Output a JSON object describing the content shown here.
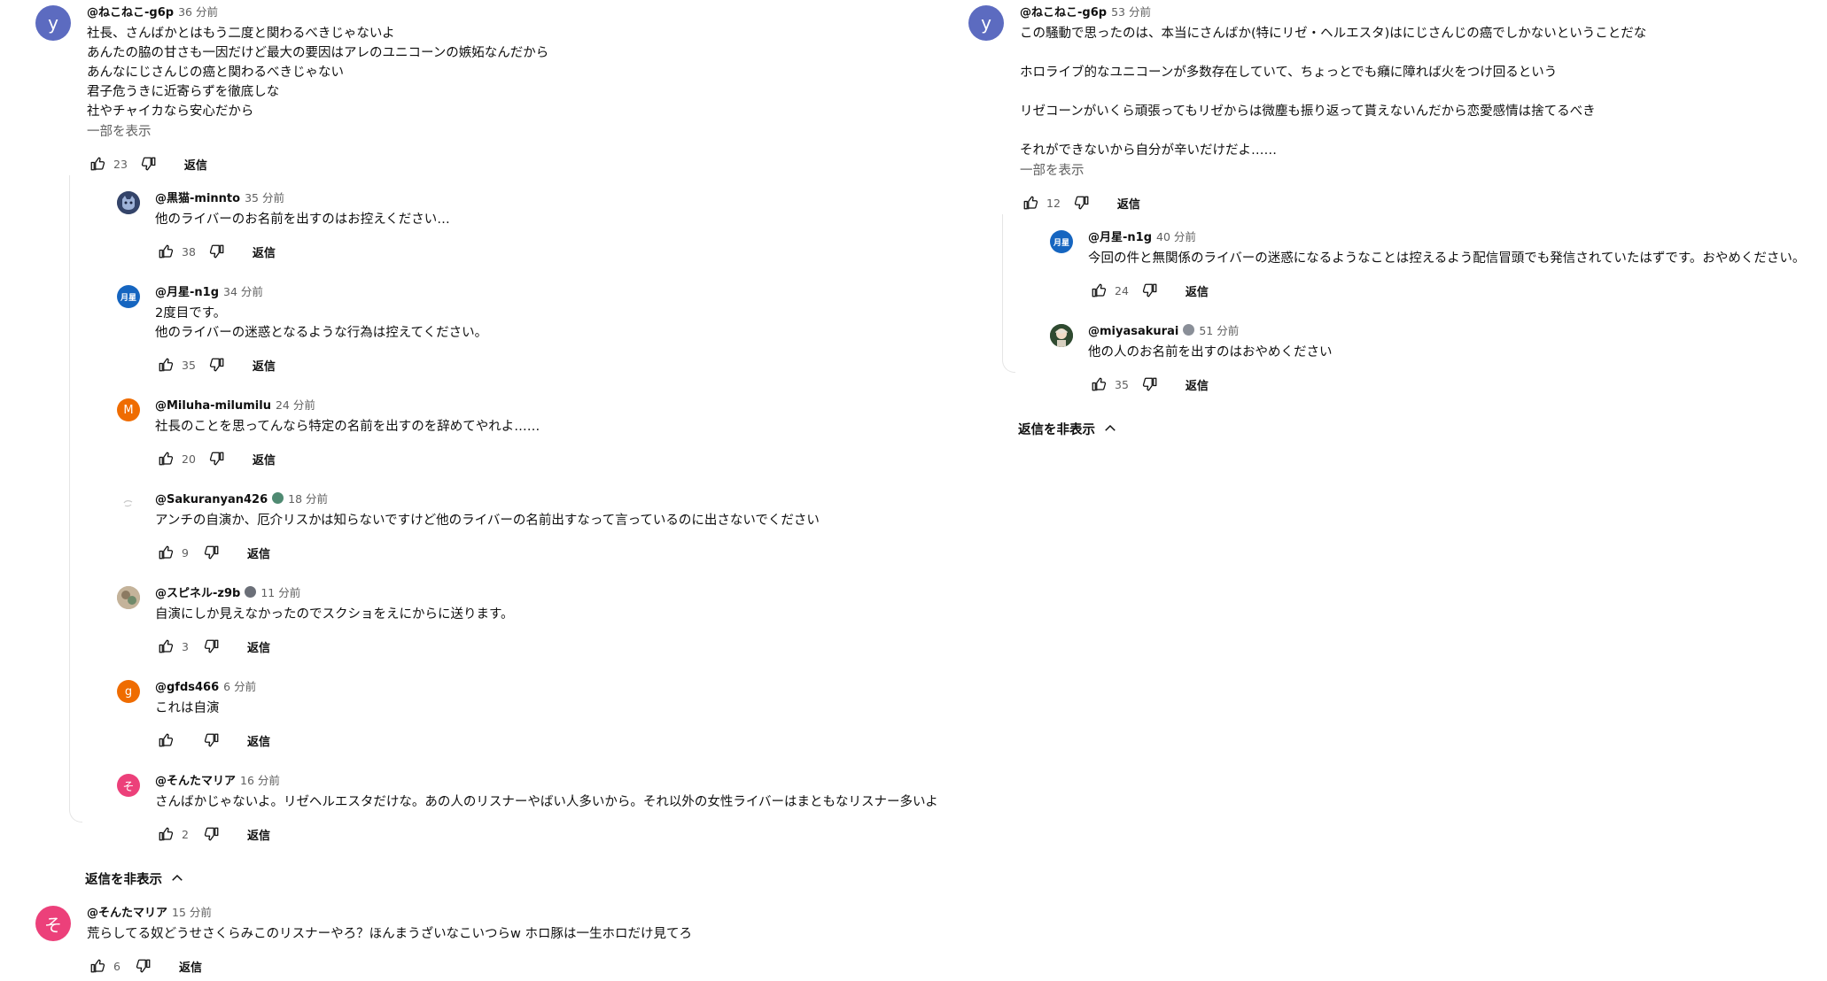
{
  "labels": {
    "reply": "返信",
    "show_more": "一部を表示",
    "hide_replies": "返信を非表示"
  },
  "colors": {
    "avatar_purple": "#5c6bc0",
    "avatar_orange": "#ef6c00",
    "avatar_pink": "#ec407a",
    "avatar_blue": "#1565c0"
  },
  "left": {
    "thread1": {
      "author": "@ねこねこ-g6p",
      "time": "36 分前",
      "avatar_letter": "y",
      "lines": [
        "社長、さんばかとはもう二度と関わるべきじゃないよ",
        "あんたの脇の甘さも一因だけど最大の要因はアレのユニコーンの嫉妬なんだから",
        "あんなにじさんじの癌と関わるべきじゃない",
        "君子危うきに近寄らずを徹底しな",
        "社やチャイカなら安心だから"
      ],
      "likes": "23",
      "replies": [
        {
          "author": "@黒猫-minnto",
          "time": "35 分前",
          "lines": [
            "他のライバーのお名前を出すのはお控えください…"
          ],
          "likes": "38",
          "avatar": "cat"
        },
        {
          "author": "@月星-n1g",
          "time": "34 分前",
          "lines": [
            "2度目です。",
            "他のライバーの迷惑となるような行為は控えてください。"
          ],
          "likes": "35",
          "avatar": "moon",
          "avatar_text": "月星"
        },
        {
          "author": "@Miluha-milumilu",
          "time": "24 分前",
          "lines": [
            "社長のことを思ってんなら特定の名前を出すのを辞めてやれよ……"
          ],
          "likes": "20",
          "avatar": "letter",
          "avatar_letter": "M"
        },
        {
          "author": "@Sakuranyan426",
          "time": "18 分前",
          "lines": [
            "アンチの自演か、厄介リスかは知らないですけど他のライバーの名前出すなって言っているのに出さないでください"
          ],
          "likes": "9",
          "avatar": "sketch",
          "badge": true
        },
        {
          "author": "@スピネル-z9b",
          "time": "11 分前",
          "lines": [
            "自演にしか見えなかったのでスクショをえにからに送ります。"
          ],
          "likes": "3",
          "avatar": "photo",
          "badge": true
        },
        {
          "author": "@gfds466",
          "time": "6 分前",
          "lines": [
            "これは自演"
          ],
          "likes": "",
          "avatar": "letter",
          "avatar_letter": "g"
        },
        {
          "author": "@そんたマリア",
          "time": "16 分前",
          "lines": [
            "さんばかじゃないよ。リゼヘルエスタだけな。あの人のリスナーやばい人多いから。それ以外の女性ライバーはまともなリスナー多いよ"
          ],
          "likes": "2",
          "avatar": "pink",
          "avatar_letter": "そ"
        }
      ]
    },
    "thread2": {
      "author": "@そんたマリア",
      "time": "15 分前",
      "avatar_letter": "そ",
      "lines": [
        "荒らしてる奴どうせさくらみこのリスナーやろ？ほんまうざいなこいつらw ホロ豚は一生ホロだけ見てろ"
      ],
      "likes": "6"
    }
  },
  "right": {
    "thread1": {
      "author": "@ねこねこ-g6p",
      "time": "53 分前",
      "avatar_letter": "y",
      "lines": [
        "この騒動で思ったのは、本当にさんばか(特にリゼ・ヘルエスタ)はにじさんじの癌でしかないということだな",
        "ホロライブ的なユニコーンが多数存在していて、ちょっとでも癪に障れば火をつけ回るという",
        "リゼコーンがいくら頑張ってもリゼからは微塵も振り返って貰えないんだから恋愛感情は捨てるべき",
        "それができないから自分が辛いだけだよ……"
      ],
      "likes": "12",
      "replies": [
        {
          "author": "@月星-n1g",
          "time": "40 分前",
          "lines": [
            "今回の件と無関係のライバーの迷惑になるようなことは控えるよう配信冒頭でも発信されていたはずです。おやめください。"
          ],
          "likes": "24",
          "avatar": "moon",
          "avatar_text": "月星"
        },
        {
          "author": "@miyasakurai",
          "time": "51 分前",
          "lines": [
            "他の人のお名前を出すのはおやめください"
          ],
          "likes": "35",
          "avatar": "girl",
          "badge": true
        }
      ]
    }
  }
}
